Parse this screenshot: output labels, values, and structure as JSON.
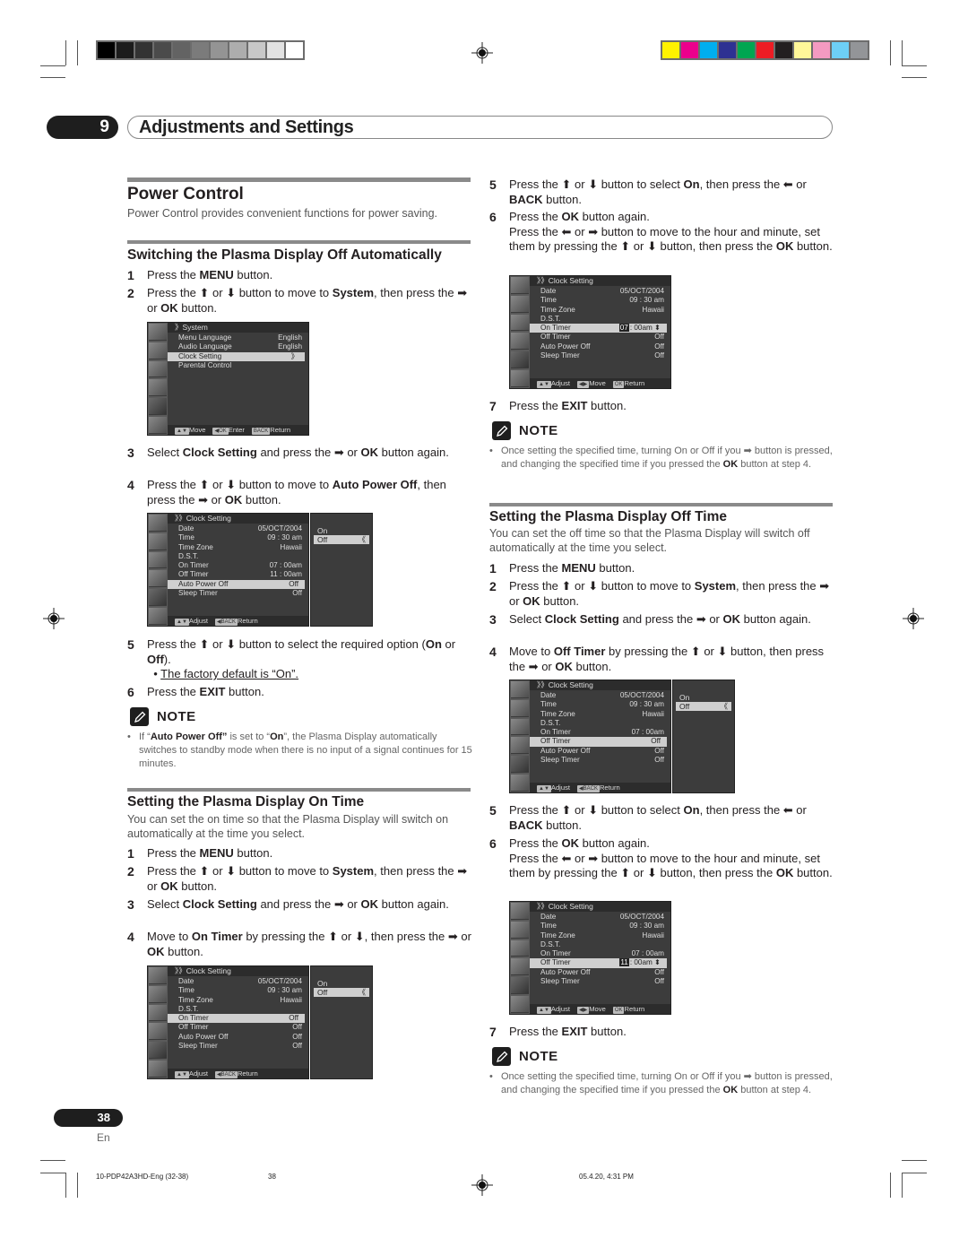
{
  "header": {
    "chapter_number": "9",
    "chapter_title": "Adjustments and Settings",
    "gray_swatches": [
      "#000000",
      "#1c1c1c",
      "#333333",
      "#4b4b4b",
      "#636363",
      "#7b7b7b",
      "#949494",
      "#adadad",
      "#c8c8c8",
      "#e2e2e2",
      "#ffffff"
    ],
    "color_swatches": [
      "#fff200",
      "#ec008c",
      "#00aeef",
      "#2e3192",
      "#00a651",
      "#ed1c24",
      "#231f20",
      "#fff799",
      "#f49ac1",
      "#6dcff6",
      "#939598"
    ]
  },
  "power_control": {
    "title": "Power Control",
    "lead": "Power Control provides convenient functions for power saving."
  },
  "auto_off": {
    "title": "Switching the Plasma Display Off Automatically",
    "steps": [
      {
        "n": "1",
        "html": "Press the <b>MENU</b> button."
      },
      {
        "n": "2",
        "html": "Press the ⬆ or ⬇ button to move to <b>System</b>, then press the ➡ or <b>OK</b> button."
      },
      {
        "n": "3",
        "html": "Select <b>Clock Setting</b> and press the ➡ or <b>OK</b> button again."
      },
      {
        "n": "4",
        "html": "Press the ⬆ or ⬇ button to move to <b>Auto Power Off</b>, then press the ➡ or <b>OK</b> button."
      },
      {
        "n": "5",
        "html": "Press the ⬆ or ⬇ button to select the required option (<b>On</b> or <b>Off</b>).<br>&nbsp;&nbsp;• <u>The factory default is “On”.</u>"
      },
      {
        "n": "6",
        "html": "Press the <b>EXIT</b> button."
      }
    ],
    "note_label": "NOTE",
    "note_html": "If “<b>Auto Power Off”</b> is set to “<b>On</b>”, the Plasma Display automatically switches to standby mode when there is no input of a signal continues for 15 minutes."
  },
  "on_time": {
    "title": "Setting the Plasma Display On Time",
    "lead": "You can set the on time so that the Plasma Display will switch on automatically at the time you select.",
    "steps": [
      {
        "n": "1",
        "html": "Press the <b>MENU</b> button."
      },
      {
        "n": "2",
        "html": "Press the ⬆ or ⬇ button to move to <b>System</b>, then press the ➡ or <b>OK</b> button."
      },
      {
        "n": "3",
        "html": "Select <b>Clock Setting</b> and press the ➡ or <b>OK</b> button again."
      },
      {
        "n": "4",
        "html": "Move to <b>On Timer</b> by pressing the ⬆ or ⬇, then press the ➡ or <b>OK</b> button."
      },
      {
        "n": "5",
        "html": "Press the ⬆ or ⬇ button to select <b>On</b>, then press the ⬅ or <b>BACK</b> button."
      },
      {
        "n": "6",
        "html": "Press the <b>OK</b> button again.<br>Press the ⬅ or ➡ button to move to the hour and minute, set them by pressing the ⬆ or ⬇ button, then press the <b>OK</b> button."
      },
      {
        "n": "7",
        "html": "Press the <b>EXIT</b> button."
      }
    ],
    "note_label": "NOTE",
    "note_html": "Once setting the specified time, turning On or Off if you ➡ button is pressed, and changing the specified time if you pressed the <b>OK</b> button at step 4."
  },
  "off_time": {
    "title": "Setting the Plasma Display Off Time",
    "lead": "You can set the off time so that the Plasma Display will switch off automatically at the time you select.",
    "steps": [
      {
        "n": "1",
        "html": "Press the <b>MENU</b> button."
      },
      {
        "n": "2",
        "html": "Press the ⬆ or ⬇ button to move to <b>System</b>, then press the ➡ or <b>OK</b> button."
      },
      {
        "n": "3",
        "html": "Select <b>Clock Setting</b> and press the ➡ or <b>OK</b> button again."
      },
      {
        "n": "4",
        "html": "Move to <b>Off Timer</b> by pressing the ⬆ or ⬇ button, then press the ➡ or <b>OK</b> button."
      },
      {
        "n": "5",
        "html": "Press the ⬆ or ⬇ button to select <b>On</b>, then press the ⬅ or <b>BACK</b> button."
      },
      {
        "n": "6",
        "html": "Press the <b>OK</b> button again.<br>Press the ⬅ or ➡ button to move to the hour and minute, set them by pressing the ⬆ or ⬇ button, then press the <b>OK</b> button."
      },
      {
        "n": "7",
        "html": "Press the <b>EXIT</b> button."
      }
    ],
    "note_label": "NOTE",
    "note_html": "Once setting the specified time, turning On or Off if you ➡ button is pressed, and changing the specified time if you pressed the <b>OK</b> button at step 4."
  },
  "screens": {
    "system": {
      "title": "》System",
      "rows": [
        [
          "Menu Language",
          "English"
        ],
        [
          "Audio Language",
          "English"
        ],
        [
          "Clock Setting",
          "》"
        ],
        [
          "Parental Control",
          ""
        ]
      ],
      "highlight": 2,
      "footer": [
        [
          "▲▼",
          "Move"
        ],
        [
          "◀OK",
          "Enter"
        ],
        [
          "BACK",
          "Return"
        ]
      ]
    },
    "auto_power_off": {
      "title": "》》Clock Setting",
      "rows": [
        [
          "Date",
          "05/OCT/2004"
        ],
        [
          "Time",
          "09 : 30 am"
        ],
        [
          "Time Zone",
          "Hawaii"
        ],
        [
          "D.S.T.",
          ""
        ],
        [
          "On Timer",
          "07 : 00am"
        ],
        [
          "Off Timer",
          "11 : 00am"
        ],
        [
          "Auto Power Off",
          "Off"
        ],
        [
          "Sleep Timer",
          "Off"
        ]
      ],
      "highlight": 6,
      "footer": [
        [
          "▲▼",
          "Adjust"
        ],
        [
          "◀BACK",
          "Return"
        ]
      ],
      "options": [
        "On",
        "Off"
      ],
      "selected_option": 1
    },
    "on_timer_select": {
      "title": "》》Clock Setting",
      "rows": [
        [
          "Date",
          "05/OCT/2004"
        ],
        [
          "Time",
          "09 : 30 am"
        ],
        [
          "Time Zone",
          "Hawaii"
        ],
        [
          "D.S.T.",
          ""
        ],
        [
          "On Timer",
          "Off"
        ],
        [
          "Off Timer",
          "Off"
        ],
        [
          "Auto Power Off",
          "Off"
        ],
        [
          "Sleep Timer",
          "Off"
        ]
      ],
      "highlight": 4,
      "footer": [
        [
          "▲▼",
          "Adjust"
        ],
        [
          "◀BACK",
          "Return"
        ]
      ],
      "options": [
        "On",
        "Off"
      ],
      "selected_option": 1
    },
    "on_timer_edit": {
      "title": "》》Clock Setting",
      "rows": [
        [
          "Date",
          "05/OCT/2004"
        ],
        [
          "Time",
          "09 : 30 am"
        ],
        [
          "Time Zone",
          "Hawaii"
        ],
        [
          "D.S.T.",
          ""
        ],
        [
          "On Timer",
          "07|: 00am ⬍"
        ],
        [
          "Off Timer",
          "Off"
        ],
        [
          "Auto Power Off",
          "Off"
        ],
        [
          "Sleep Timer",
          "Off"
        ]
      ],
      "highlight": 4,
      "footer": [
        [
          "▲▼",
          "Adjust"
        ],
        [
          "◀▶",
          "Move"
        ],
        [
          "OK",
          "Return"
        ]
      ]
    },
    "off_timer_select": {
      "title": "》》Clock Setting",
      "rows": [
        [
          "Date",
          "05/OCT/2004"
        ],
        [
          "Time",
          "09 : 30 am"
        ],
        [
          "Time Zone",
          "Hawaii"
        ],
        [
          "D.S.T.",
          ""
        ],
        [
          "On Timer",
          "07 : 00am"
        ],
        [
          "Off Timer",
          "Off"
        ],
        [
          "Auto Power Off",
          "Off"
        ],
        [
          "Sleep Timer",
          "Off"
        ]
      ],
      "highlight": 5,
      "footer": [
        [
          "▲▼",
          "Adjust"
        ],
        [
          "◀BACK",
          "Return"
        ]
      ],
      "options": [
        "On",
        "Off"
      ],
      "selected_option": 1
    },
    "off_timer_edit": {
      "title": "》》Clock Setting",
      "rows": [
        [
          "Date",
          "05/OCT/2004"
        ],
        [
          "Time",
          "09 : 30 am"
        ],
        [
          "Time Zone",
          "Hawaii"
        ],
        [
          "D.S.T.",
          ""
        ],
        [
          "On Timer",
          "07 : 00am"
        ],
        [
          "Off Timer",
          "11|: 00am ⬍"
        ],
        [
          "Auto Power Off",
          "Off"
        ],
        [
          "Sleep Timer",
          "Off"
        ]
      ],
      "highlight": 5,
      "footer": [
        [
          "▲▼",
          "Adjust"
        ],
        [
          "◀▶",
          "Move"
        ],
        [
          "OK",
          "Return"
        ]
      ]
    }
  },
  "footer": {
    "page_number": "38",
    "language": "En",
    "file_name": "10-PDP42A3HD-Eng (32-38)",
    "file_page": "38",
    "timestamp": "05.4.20, 4:31 PM"
  }
}
